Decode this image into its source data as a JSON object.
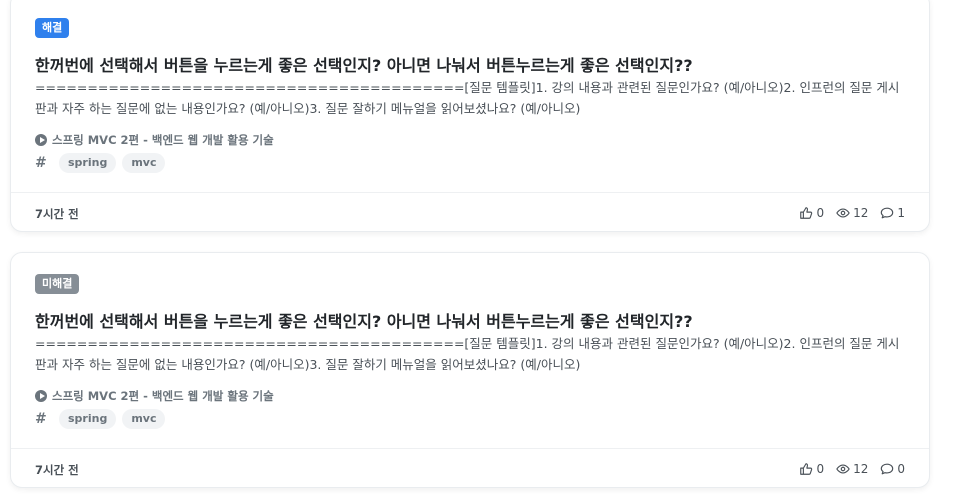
{
  "posts": [
    {
      "status": "해결",
      "title": "한꺼번에 선택해서 버튼을 누르는게 좋은 선택인지? 아니면 나눠서 버튼누르는게 좋은 선택인지??",
      "excerpt": "=========================================[질문 템플릿]1. 강의 내용과 관련된 질문인가요? (예/아니오)2. 인프런의 질문 게시판과 자주 하는 질문에 없는 내용인가요? (예/아니오)3. 질문 잘하기 메뉴얼을 읽어보셨나요? (예/아니오)",
      "course": "스프링 MVC 2편 - 백엔드 웹 개발 활용 기술",
      "tags": [
        "spring",
        "mvc"
      ],
      "time": "7시간 전",
      "likes": "0",
      "views": "12",
      "comments": "1"
    },
    {
      "status": "미해결",
      "title": "한꺼번에 선택해서 버튼을 누르는게 좋은 선택인지? 아니면 나눠서 버튼누르는게 좋은 선택인지??",
      "excerpt": "=========================================[질문 템플릿]1. 강의 내용과 관련된 질문인가요? (예/아니오)2. 인프런의 질문 게시판과 자주 하는 질문에 없는 내용인가요? (예/아니오)3. 질문 잘하기 메뉴얼을 읽어보셨나요? (예/아니오)",
      "course": "스프링 MVC 2편 - 백엔드 웹 개발 활용 기술",
      "tags": [
        "spring",
        "mvc"
      ],
      "time": "7시간 전",
      "likes": "0",
      "views": "12",
      "comments": "0"
    }
  ],
  "icons": {
    "like": "thumbs-up-icon",
    "view": "eye-icon",
    "comment": "comment-icon",
    "course": "play-icon",
    "tag": "hash-icon"
  },
  "colors": {
    "solved": "#2f80ed",
    "unsolved": "#868e96"
  }
}
